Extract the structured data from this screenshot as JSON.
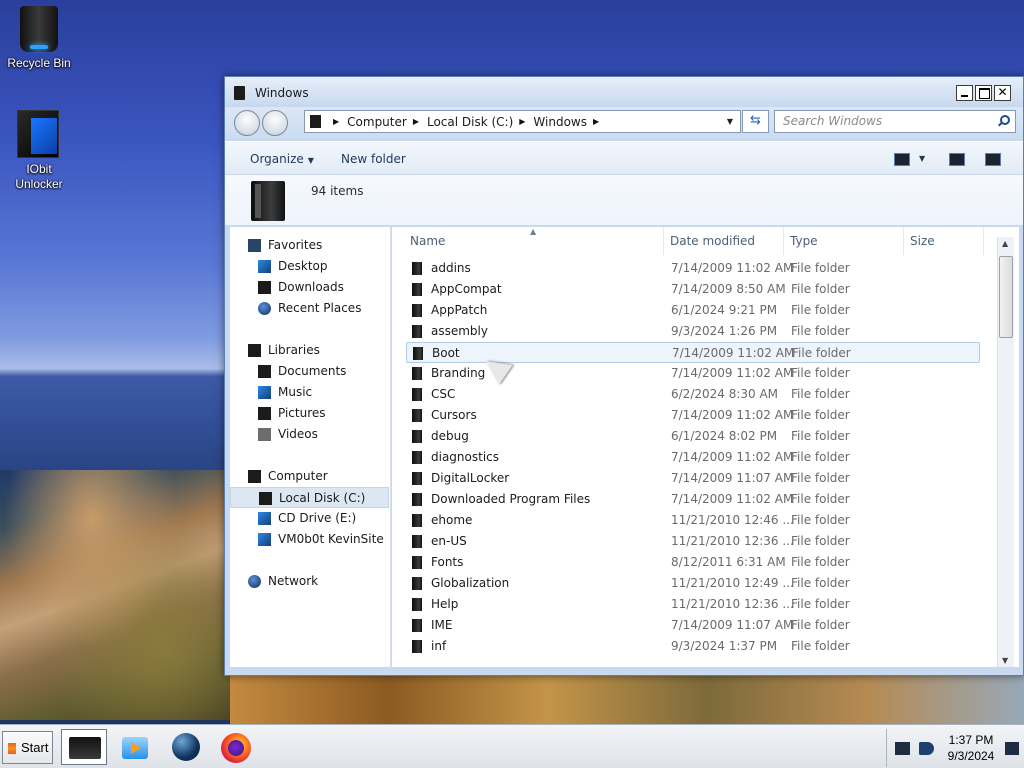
{
  "desktop": {
    "icons": [
      {
        "label": "Recycle Bin",
        "icon": "recycle-bin-icon"
      },
      {
        "label": "IObit Unlocker",
        "icon": "iobit-unlocker-icon"
      }
    ]
  },
  "window": {
    "title": "Windows",
    "address": {
      "crumbs": [
        "Computer",
        "Local Disk (C:)",
        "Windows"
      ]
    },
    "search": {
      "placeholder": "Search Windows"
    },
    "commands": {
      "organize": "Organize",
      "new_folder": "New folder"
    },
    "details": {
      "count": "94 items"
    },
    "nav": {
      "favorites": {
        "label": "Favorites",
        "items": [
          "Desktop",
          "Downloads",
          "Recent Places"
        ]
      },
      "libraries": {
        "label": "Libraries",
        "items": [
          "Documents",
          "Music",
          "Pictures",
          "Videos"
        ]
      },
      "computer": {
        "label": "Computer",
        "items": [
          "Local Disk (C:)",
          "CD Drive (E:)",
          "VM0b0t KevinSite"
        ]
      },
      "network": {
        "label": "Network"
      }
    },
    "columns": {
      "name": "Name",
      "date": "Date modified",
      "type": "Type",
      "size": "Size"
    },
    "rows": [
      {
        "name": "addins",
        "date": "7/14/2009 11:02 AM",
        "type": "File folder"
      },
      {
        "name": "AppCompat",
        "date": "7/14/2009 8:50 AM",
        "type": "File folder"
      },
      {
        "name": "AppPatch",
        "date": "6/1/2024 9:21 PM",
        "type": "File folder"
      },
      {
        "name": "assembly",
        "date": "9/3/2024 1:26 PM",
        "type": "File folder"
      },
      {
        "name": "Boot",
        "date": "7/14/2009 11:02 AM",
        "type": "File folder"
      },
      {
        "name": "Branding",
        "date": "7/14/2009 11:02 AM",
        "type": "File folder"
      },
      {
        "name": "CSC",
        "date": "6/2/2024 8:30 AM",
        "type": "File folder"
      },
      {
        "name": "Cursors",
        "date": "7/14/2009 11:02 AM",
        "type": "File folder"
      },
      {
        "name": "debug",
        "date": "6/1/2024 8:02 PM",
        "type": "File folder"
      },
      {
        "name": "diagnostics",
        "date": "7/14/2009 11:02 AM",
        "type": "File folder"
      },
      {
        "name": "DigitalLocker",
        "date": "7/14/2009 11:07 AM",
        "type": "File folder"
      },
      {
        "name": "Downloaded Program Files",
        "date": "7/14/2009 11:02 AM",
        "type": "File folder"
      },
      {
        "name": "ehome",
        "date": "11/21/2010 12:46 ...",
        "type": "File folder"
      },
      {
        "name": "en-US",
        "date": "11/21/2010 12:36 ...",
        "type": "File folder"
      },
      {
        "name": "Fonts",
        "date": "8/12/2011 6:31 AM",
        "type": "File folder"
      },
      {
        "name": "Globalization",
        "date": "11/21/2010 12:49 ...",
        "type": "File folder"
      },
      {
        "name": "Help",
        "date": "11/21/2010 12:36 ...",
        "type": "File folder"
      },
      {
        "name": "IME",
        "date": "7/14/2009 11:07 AM",
        "type": "File folder"
      },
      {
        "name": "inf",
        "date": "9/3/2024 1:37 PM",
        "type": "File folder"
      }
    ],
    "selected_row": "Boot"
  },
  "taskbar": {
    "start_label": "Start",
    "apps": [
      {
        "name": "windows-explorer"
      },
      {
        "name": "windows-media-player"
      },
      {
        "name": "internet-explorer"
      },
      {
        "name": "firefox"
      }
    ],
    "clock": {
      "time": "1:37 PM",
      "date": "9/3/2024"
    }
  }
}
